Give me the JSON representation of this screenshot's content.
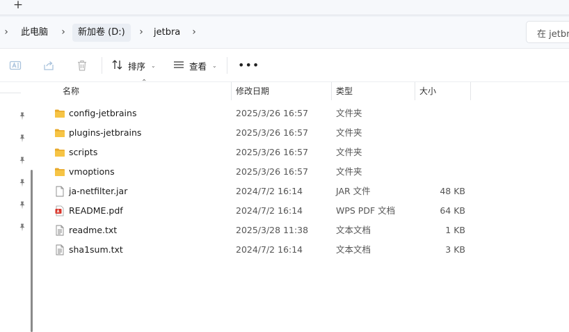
{
  "tabstrip": {
    "new_tab_glyph": "+"
  },
  "address": {
    "crumbs": [
      "此电脑",
      "新加卷 (D:)",
      "jetbra"
    ],
    "search_placeholder": "在 jetbra"
  },
  "toolbar": {
    "sort_label": "排序",
    "view_label": "查看",
    "more_label": "•••",
    "icons": [
      "rename-icon",
      "share-icon",
      "delete-icon",
      "sort-icon",
      "view-icon"
    ]
  },
  "columns": {
    "name": "名称",
    "date": "修改日期",
    "type": "类型",
    "size": "大小"
  },
  "files": [
    {
      "name": "config-jetbrains",
      "date": "2025/3/26 16:57",
      "type": "文件夹",
      "size": "",
      "icon": "folder-icon"
    },
    {
      "name": "plugins-jetbrains",
      "date": "2025/3/26 16:57",
      "type": "文件夹",
      "size": "",
      "icon": "folder-icon"
    },
    {
      "name": "scripts",
      "date": "2025/3/26 16:57",
      "type": "文件夹",
      "size": "",
      "icon": "folder-icon"
    },
    {
      "name": "vmoptions",
      "date": "2025/3/26 16:57",
      "type": "文件夹",
      "size": "",
      "icon": "folder-icon"
    },
    {
      "name": "ja-netfilter.jar",
      "date": "2024/7/2 16:14",
      "type": "JAR 文件",
      "size": "48 KB",
      "icon": "file-icon"
    },
    {
      "name": "README.pdf",
      "date": "2024/7/2 16:14",
      "type": "WPS PDF 文档",
      "size": "64 KB",
      "icon": "pdf-icon"
    },
    {
      "name": "readme.txt",
      "date": "2025/3/28 11:38",
      "type": "文本文档",
      "size": "1 KB",
      "icon": "text-file-icon"
    },
    {
      "name": "sha1sum.txt",
      "date": "2024/7/2 16:14",
      "type": "文本文档",
      "size": "3 KB",
      "icon": "text-file-icon"
    }
  ],
  "colors": {
    "folder": "#f6c445",
    "folder_dark": "#e8a92a",
    "pdf": "#d9362b",
    "accent": "#0067c0"
  }
}
